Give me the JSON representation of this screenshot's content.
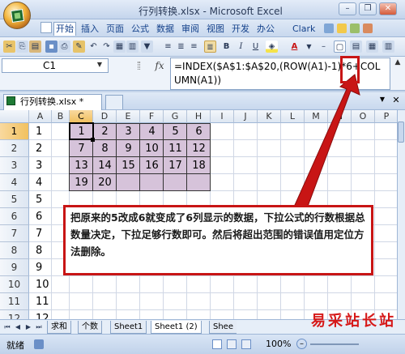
{
  "window": {
    "title": "行列转换.xlsx - Microsoft Excel",
    "controls": [
      "–",
      "❐",
      "✕"
    ]
  },
  "ribbon_tabs": [
    {
      "label": "开始",
      "active": true
    },
    {
      "label": "插入"
    },
    {
      "label": "页面"
    },
    {
      "label": "公式"
    },
    {
      "label": "数据"
    },
    {
      "label": "审阅"
    },
    {
      "label": "视图"
    },
    {
      "label": "开发"
    },
    {
      "label": "办公"
    },
    {
      "label": "Clark"
    }
  ],
  "toolbar": [
    "cut-icon",
    "copy-icon",
    "paste-icon",
    "save-icon",
    "print-icon",
    "format-painter-icon",
    "undo-icon",
    "redo-icon",
    "align-left-icon",
    "align-center-icon",
    "align-right-icon",
    "bold-icon",
    "italic-icon",
    "underline-icon",
    "fill-color-icon",
    "font-color-icon",
    "border-icon",
    "merge-icon",
    "table-icon"
  ],
  "toolbar_glyphs": {
    "bold": "B",
    "italic": "I",
    "underline": "U",
    "font_color": "A"
  },
  "formula_bar": {
    "name_box": "C1",
    "fx": "fx",
    "formula": "=INDEX($A$1:$A$20,(ROW(A1)-1)*6+COLUMN(A1))"
  },
  "workbook": {
    "tab_label": "行列转换.xlsx *"
  },
  "columns": [
    "A",
    "B",
    "C",
    "D",
    "E",
    "F",
    "G",
    "H",
    "I",
    "J",
    "K",
    "L",
    "M",
    "N",
    "O",
    "P"
  ],
  "rows": [
    "1",
    "2",
    "3",
    "4",
    "5",
    "6",
    "7",
    "8",
    "9",
    "10",
    "11",
    "12"
  ],
  "column_a": [
    "1",
    "2",
    "3",
    "4",
    "5",
    "6",
    "7",
    "8",
    "9",
    "10",
    "11",
    "12"
  ],
  "result_table": [
    [
      "1",
      "2",
      "3",
      "4",
      "5",
      "6"
    ],
    [
      "7",
      "8",
      "9",
      "10",
      "11",
      "12"
    ],
    [
      "13",
      "14",
      "15",
      "16",
      "17",
      "18"
    ],
    [
      "19",
      "20",
      "",
      "",
      "",
      ""
    ]
  ],
  "sheets": [
    {
      "label": "求和"
    },
    {
      "label": "个数"
    },
    {
      "label": "Sheet1"
    },
    {
      "label": "Sheet1 (2)",
      "current": true
    },
    {
      "label": "Shee"
    }
  ],
  "status": {
    "ready": "就绪",
    "zoom": "100%"
  },
  "annotation": {
    "callout_text": "把原来的5改成6就变成了6列显示的数据，下拉公式的行数根据总数量决定，下拉足够行数即可。然后将超出范围的错误值用定位方法删除。",
    "highlight_text": "6"
  },
  "watermark": "易采站长站",
  "colors": {
    "purple_fill": "#d6c3da",
    "annotation_red": "#c81515",
    "selected_header": "#f1c15f"
  }
}
